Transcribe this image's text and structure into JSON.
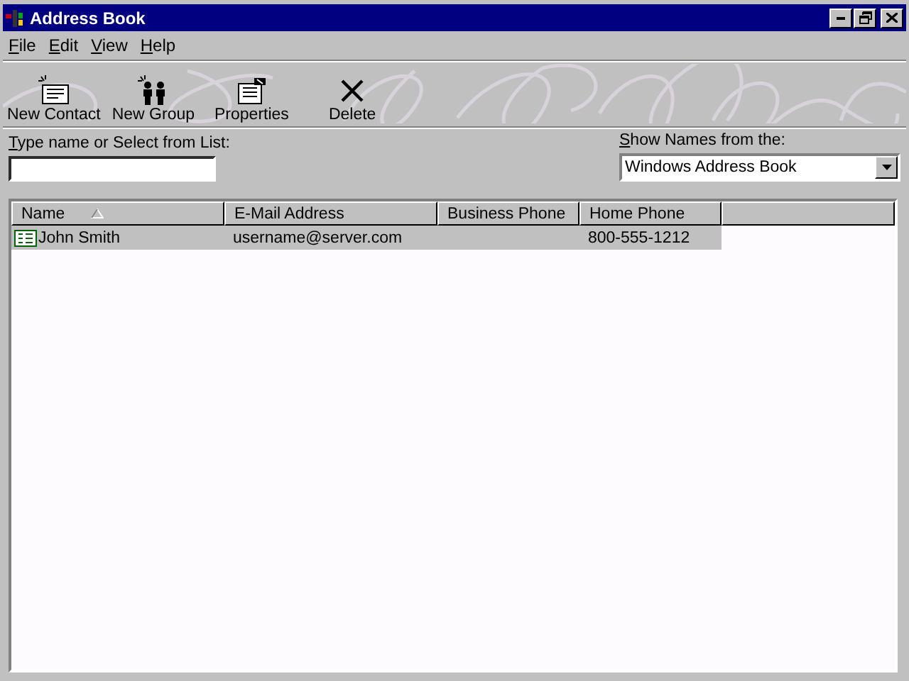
{
  "window": {
    "title": "Address Book"
  },
  "menu": [
    {
      "access_key": "F",
      "label_rest": "ile"
    },
    {
      "access_key": "E",
      "label_rest": "dit"
    },
    {
      "access_key": "V",
      "label_rest": "iew"
    },
    {
      "access_key": "H",
      "label_rest": "elp"
    }
  ],
  "toolbar": [
    {
      "label": "New Contact",
      "kind": "contact"
    },
    {
      "label": "New Group",
      "kind": "group"
    },
    {
      "label": "Properties",
      "kind": "properties"
    },
    {
      "label": "Delete",
      "kind": "delete"
    }
  ],
  "search": {
    "access_key": "T",
    "label_rest": "ype name or Select from List:"
  },
  "source": {
    "access_key": "S",
    "label_rest": "how Names from the:",
    "value": "Windows Address Book"
  },
  "table": {
    "columns": [
      {
        "label": "Name",
        "sorted": true
      },
      {
        "label": "E-Mail Address",
        "sorted": false
      },
      {
        "label": "Business Phone",
        "sorted": false
      },
      {
        "label": "Home Phone",
        "sorted": false
      }
    ],
    "rows": [
      {
        "cells": [
          "John Smith",
          "username@server.com",
          "",
          "800-555-1212"
        ],
        "selected": true
      }
    ]
  }
}
